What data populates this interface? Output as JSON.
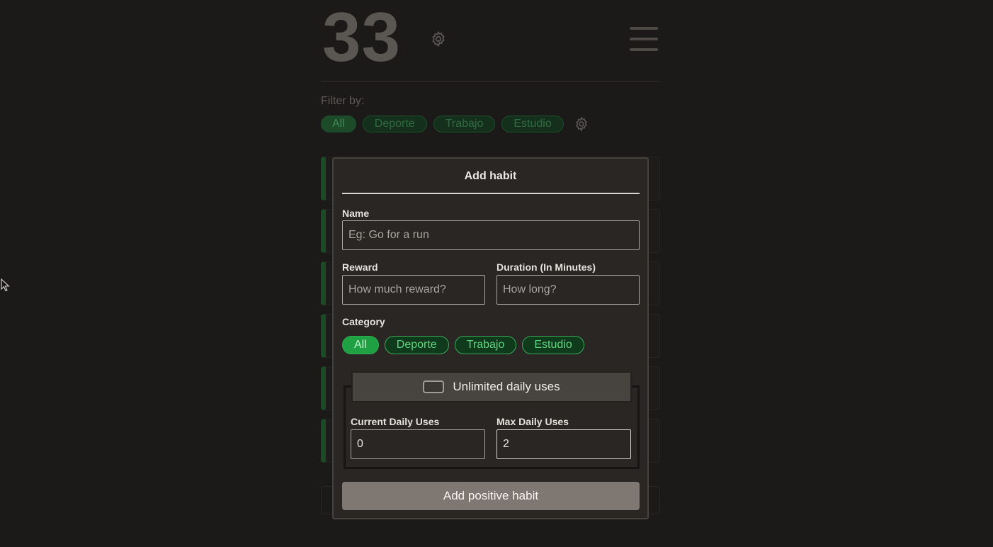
{
  "app": {
    "score": "33",
    "filter": {
      "label": "Filter by:",
      "options": [
        "All",
        "Deporte",
        "Trabajo",
        "Estudio"
      ],
      "selected": "All"
    }
  },
  "modal": {
    "title": "Add habit",
    "name": {
      "label": "Name",
      "placeholder": "Eg: Go for a run",
      "value": ""
    },
    "reward": {
      "label": "Reward",
      "placeholder": "How much reward?",
      "value": ""
    },
    "duration": {
      "label": "Duration (In Minutes)",
      "placeholder": "How long?",
      "value": ""
    },
    "category": {
      "label": "Category",
      "options": [
        "All",
        "Deporte",
        "Trabajo",
        "Estudio"
      ],
      "selected": "All"
    },
    "unlimited": {
      "label": "Unlimited daily uses",
      "checked": false
    },
    "current_uses": {
      "label": "Current Daily Uses",
      "value": "0"
    },
    "max_uses": {
      "label": "Max Daily Uses",
      "value": "2"
    },
    "submit_label": "Add positive habit"
  },
  "colors": {
    "accent_green": "#1fa043",
    "pill_text_green": "#5fd47e",
    "button_gray": "#7e7772"
  },
  "icons": [
    "gear-icon",
    "hamburger-menu-icon",
    "mouse-cursor-icon"
  ]
}
